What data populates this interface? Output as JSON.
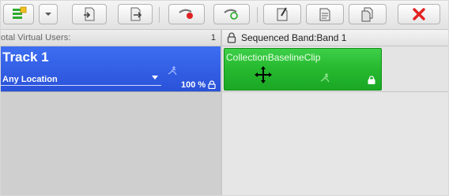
{
  "header": {
    "total_users_label": "otal Virtual Users:",
    "total_users_value": "1",
    "band_label": "Sequenced Band:Band 1"
  },
  "track": {
    "title": "Track 1",
    "location": "Any Location",
    "percent": "100 %"
  },
  "clip": {
    "title": "CollectionBaselineClip"
  },
  "colors": {
    "track_blue": "#2f5ee5",
    "clip_green": "#2bbd33",
    "delete_red": "#e32222"
  },
  "toolbar": {
    "icons": [
      "add-track-icon",
      "dropdown-arrow-icon",
      "import-icon",
      "export-icon",
      "record-icon",
      "run-icon",
      "edit-icon",
      "properties-icon",
      "copy-icon",
      "delete-icon"
    ]
  }
}
